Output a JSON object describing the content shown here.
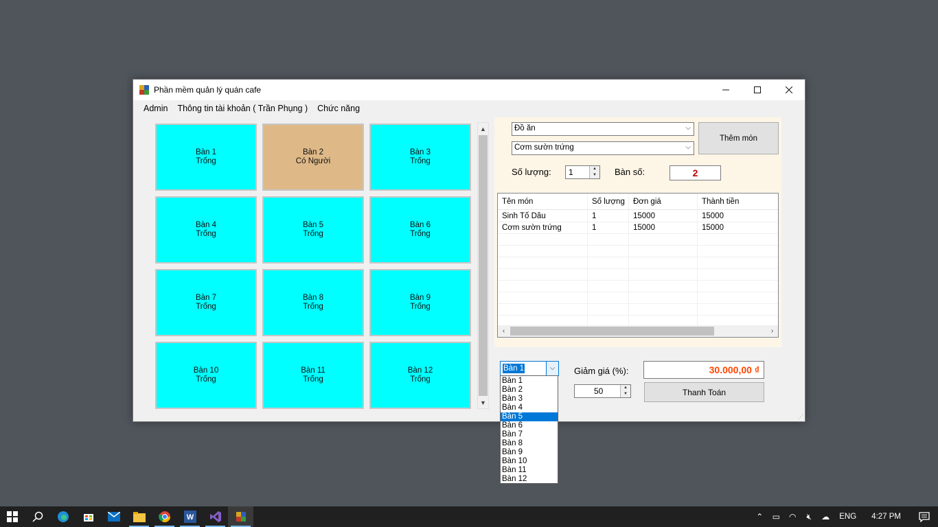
{
  "window": {
    "title": "Phần mềm quản lý quán cafe",
    "controls": {
      "minimize": "—",
      "maximize": "☐",
      "close": "✕"
    }
  },
  "menu": [
    "Admin",
    "Thông tin tài khoản ( Trần Phụng )",
    "Chức năng"
  ],
  "tables": [
    {
      "name": "Bàn 1",
      "status": "Trống",
      "color": "#00ffff"
    },
    {
      "name": "Bàn 2",
      "status": "Có Người",
      "color": "#deb887"
    },
    {
      "name": "Bàn 3",
      "status": "Trống",
      "color": "#00ffff"
    },
    {
      "name": "Bàn 4",
      "status": "Trống",
      "color": "#00ffff"
    },
    {
      "name": "Bàn 5",
      "status": "Trống",
      "color": "#00ffff"
    },
    {
      "name": "Bàn 6",
      "status": "Trống",
      "color": "#00ffff"
    },
    {
      "name": "Bàn 7",
      "status": "Trống",
      "color": "#00ffff"
    },
    {
      "name": "Bàn 8",
      "status": "Trống",
      "color": "#00ffff"
    },
    {
      "name": "Bàn 9",
      "status": "Trống",
      "color": "#00ffff"
    },
    {
      "name": "Bàn 10",
      "status": "Trống",
      "color": "#00ffff"
    },
    {
      "name": "Bàn 11",
      "status": "Trống",
      "color": "#00ffff"
    },
    {
      "name": "Bàn 12",
      "status": "Trống",
      "color": "#00ffff"
    }
  ],
  "order": {
    "category": "Đồ ăn",
    "food": "Cơm sườn trứng",
    "add_button": "Thêm món",
    "quantity_label": "Số lượng:",
    "quantity_value": "1",
    "table_no_label": "Bàn số:",
    "table_no_value": "2"
  },
  "bill": {
    "columns": [
      "Tên món",
      "Số lượng",
      "Đơn giá",
      "Thành tiền"
    ],
    "rows": [
      [
        "Sinh Tố Dâu",
        "1",
        "15000",
        "15000"
      ],
      [
        "Cơm sườn trứng",
        "1",
        "15000",
        "15000"
      ]
    ]
  },
  "checkout": {
    "selected_table": "Bàn 1",
    "discount_label": "Giảm giá (%):",
    "discount_value": "50",
    "total": "30.000,00 ₫",
    "pay_button": "Thanh Toán"
  },
  "dropdown": {
    "items": [
      "Bàn 1",
      "Bàn 2",
      "Bàn 3",
      "Bàn 4",
      "Bàn 5",
      "Bàn 6",
      "Bàn 7",
      "Bàn 8",
      "Bàn 9",
      "Bàn 10",
      "Bàn 11",
      "Bàn 12"
    ],
    "highlighted": "Bàn 5"
  },
  "taskbar": {
    "apps": [
      "start-icon",
      "search-icon",
      "edge-icon",
      "store-icon",
      "mail-icon",
      "file-explorer-icon",
      "chrome-icon",
      "word-icon",
      "visual-studio-icon",
      "cafe-app-icon"
    ],
    "language": "ENG",
    "time": "4:27 PM"
  }
}
